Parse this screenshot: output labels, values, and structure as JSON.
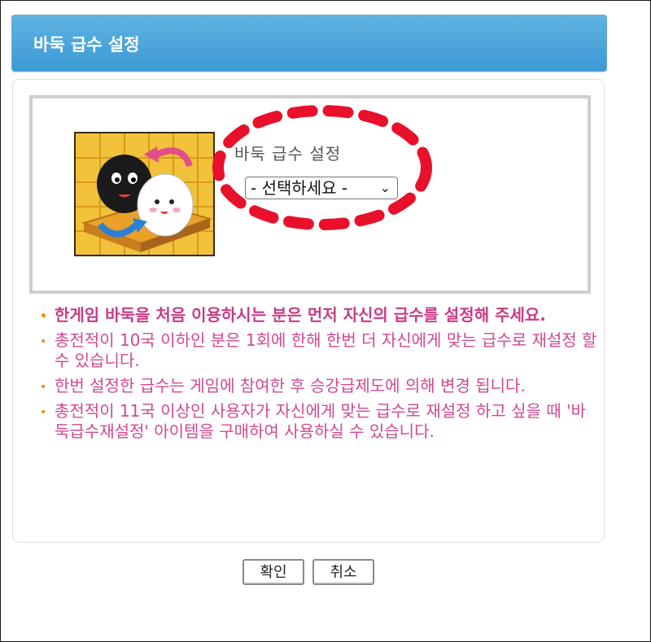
{
  "header": {
    "title": "바둑 급수 설정"
  },
  "setting": {
    "label": "바둑 급수 설정",
    "select": {
      "selected": "- 선택하세요 -"
    }
  },
  "notes": [
    "한게임 바둑을 처음 이용하시는 분은 먼저 자신의 급수를 설정해 주세요.",
    "총전적이 10국 이하인 분은 1회에 한해 한번 더 자신에게 맞는 급수로 재설정 할 수 있습니다.",
    "한번 설정한 급수는 게임에 참여한 후 승강급제도에 의해 변경 됩니다.",
    "총전적이 11국 이상인 사용자가 자신에게 맞는 급수로 재설정 하고 싶을 때 '바둑급수재설정' 아이템을 구매하여 사용하실 수 있습니다."
  ],
  "buttons": {
    "confirm": "확인",
    "cancel": "취소"
  },
  "colors": {
    "header": "#4aa6da",
    "note_text": "#d2488f",
    "bullet": "#f08a1c",
    "highlight": "#e8102a"
  },
  "icons": {
    "game": "baduk-stones-icon",
    "dropdown": "chevron-down-icon"
  }
}
